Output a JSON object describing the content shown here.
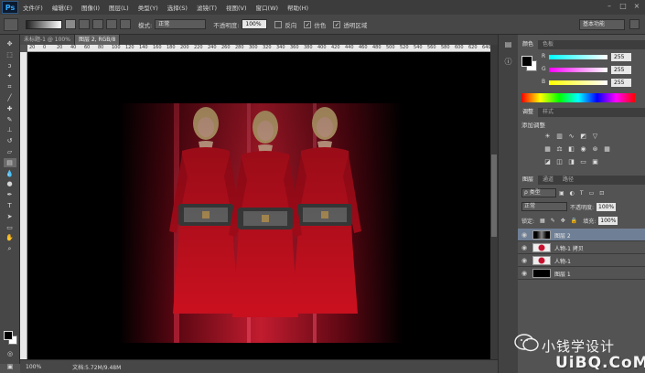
{
  "app": {
    "logo": "Ps"
  },
  "menu": [
    "文件(F)",
    "编辑(E)",
    "图像(I)",
    "图层(L)",
    "类型(Y)",
    "选择(S)",
    "滤镜(T)",
    "视图(V)",
    "窗口(W)",
    "帮助(H)"
  ],
  "options": {
    "mode_label": "模式:",
    "mode_value": "正常",
    "opacity_label": "不透明度:",
    "opacity_value": "100%",
    "reverse_label": "反向",
    "dither_label": "仿色",
    "transparency_label": "透明区域",
    "workspace": "基本功能"
  },
  "tabs": [
    "未标题-1 @ 100%",
    "图层 2, RGB/8"
  ],
  "ruler_ticks": [
    "20",
    "0",
    "20",
    "40",
    "60",
    "80",
    "100",
    "120",
    "140",
    "160",
    "180",
    "200",
    "220",
    "240",
    "260",
    "280",
    "300",
    "320",
    "340",
    "360",
    "380",
    "400",
    "420",
    "440",
    "460",
    "480",
    "500",
    "520",
    "540",
    "560",
    "580",
    "600",
    "620",
    "640"
  ],
  "status": {
    "zoom": "100%",
    "doc_info": "文档:5.72M/9.48M"
  },
  "color_panel": {
    "tabs": [
      "颜色",
      "色板"
    ],
    "channels": [
      {
        "label": "R",
        "value": "255",
        "from": "#00ffff",
        "to": "#ffffff"
      },
      {
        "label": "G",
        "value": "255",
        "from": "#ff00ff",
        "to": "#ffffff"
      },
      {
        "label": "B",
        "value": "255",
        "from": "#ffff00",
        "to": "#ffffff"
      }
    ]
  },
  "adjustments": {
    "tabs": [
      "调整",
      "样式"
    ],
    "title": "添加调整"
  },
  "layers": {
    "tabs": [
      "图层",
      "通道",
      "路径"
    ],
    "filter_value": "ρ 类型",
    "blend_mode": "正常",
    "opacity_label": "不透明度:",
    "opacity_value": "100%",
    "lock_label": "锁定:",
    "fill_label": "填充:",
    "fill_value": "100%",
    "items": [
      {
        "name": "图层 2",
        "thumb": "dark",
        "selected": true
      },
      {
        "name": "人物-1 拷贝",
        "thumb": "figure",
        "selected": false
      },
      {
        "name": "人物-1",
        "thumb": "figure",
        "selected": false
      },
      {
        "name": "图层 1",
        "thumb": "black",
        "selected": false
      }
    ]
  },
  "watermark": {
    "text": "小钱学设计",
    "site": "UiBQ.CoM"
  },
  "colors": {
    "accent_red": "#c8102e",
    "selected_layer": "#6f7f95"
  }
}
